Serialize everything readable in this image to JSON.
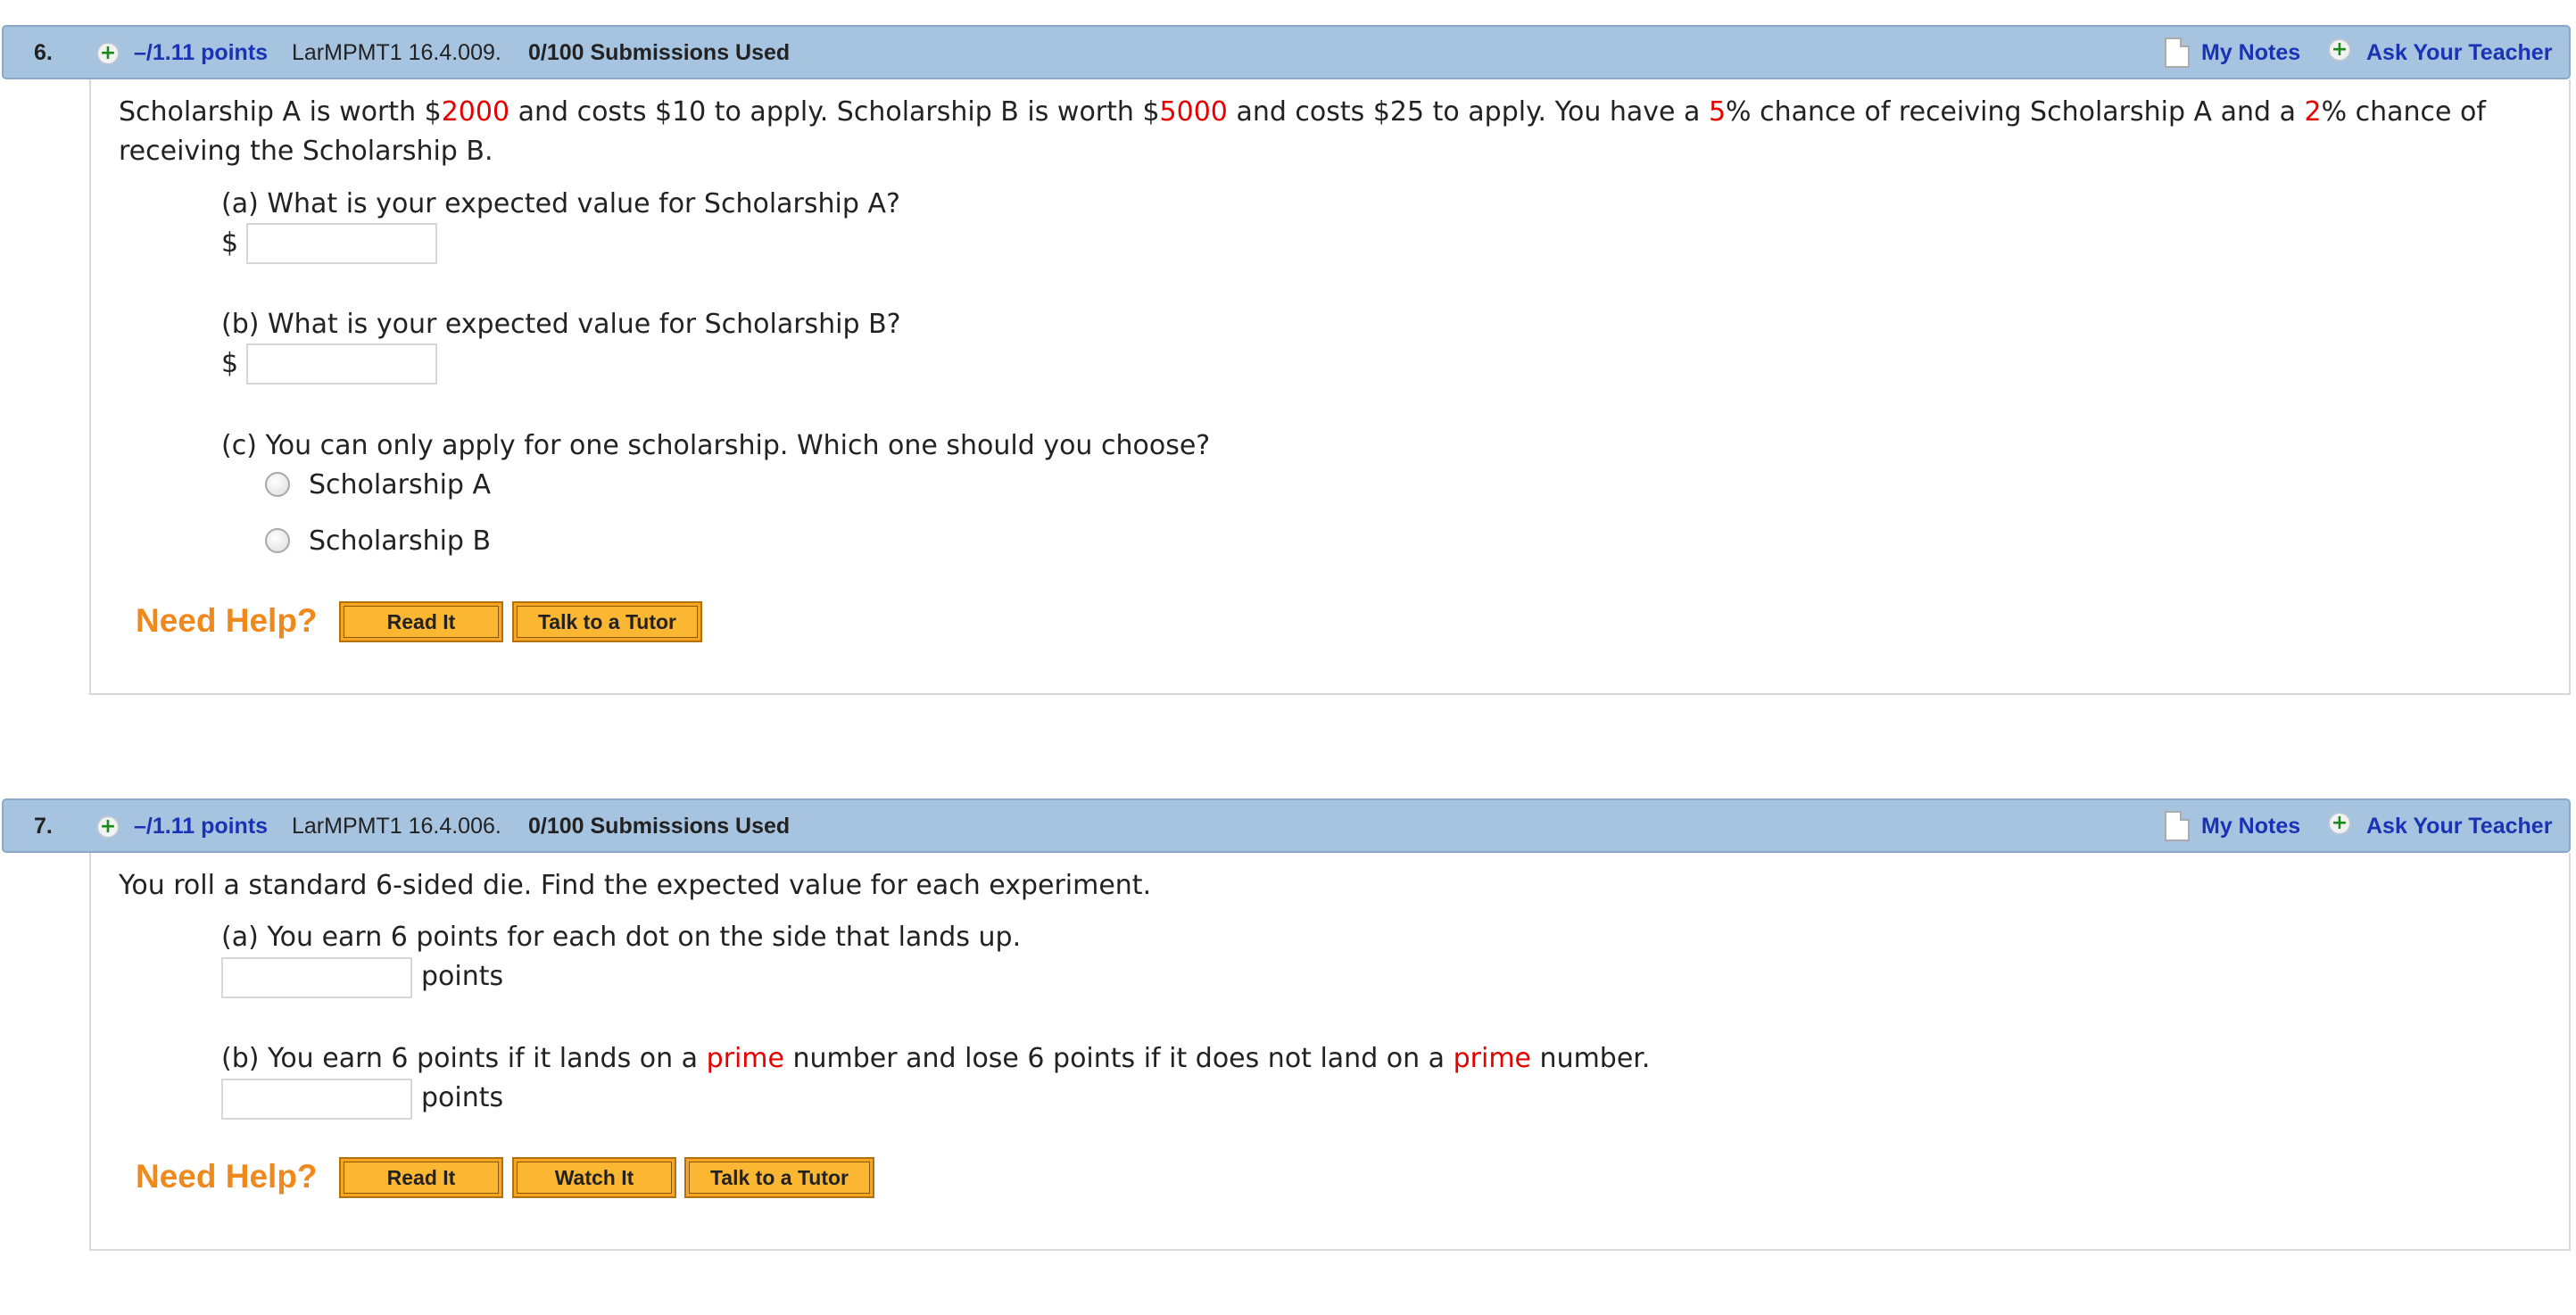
{
  "questions": [
    {
      "number": "6.",
      "points": "–/1.11 points",
      "code": "LarMPMT1 16.4.009.",
      "submissions": "0/100 Submissions Used",
      "my_notes": "My Notes",
      "ask_teacher": "Ask Your Teacher",
      "prompt": {
        "s1": "Scholarship A is worth $",
        "v1": "2000",
        "s2": " and costs $10 to apply. Scholarship B is worth $",
        "v2": "5000",
        "s3": " and costs $25 to apply. You have a ",
        "v3": "5",
        "s4": "% chance of receiving Scholarship A and a ",
        "v4": "2",
        "s5": "% chance of",
        "line2": "receiving the Scholarship B."
      },
      "part_a": "(a) What is your expected value for Scholarship A?",
      "part_a_unit": "$",
      "part_b": "(b) What is your expected value for Scholarship B?",
      "part_b_unit": "$",
      "part_c": "(c) You can only apply for one scholarship. Which one should you choose?",
      "options": [
        "Scholarship A",
        "Scholarship B"
      ],
      "need_help": "Need Help?",
      "buttons": [
        "Read It",
        "Talk to a Tutor"
      ]
    },
    {
      "number": "7.",
      "points": "–/1.11 points",
      "code": "LarMPMT1 16.4.006.",
      "submissions": "0/100 Submissions Used",
      "my_notes": "My Notes",
      "ask_teacher": "Ask Your Teacher",
      "prompt": "You roll a standard 6-sided die. Find the expected value for each experiment.",
      "part_a": "(a) You earn 6 points for each dot on the side that lands up.",
      "part_a_unit": "points",
      "part_b": {
        "s1": "(b) You earn 6 points if it lands on a ",
        "w1": "prime",
        "s2": " number and lose 6 points if it does not land on a ",
        "w2": "prime",
        "s3": " number."
      },
      "part_b_unit": "points",
      "need_help": "Need Help?",
      "buttons": [
        "Read It",
        "Watch It",
        "Talk to a Tutor"
      ]
    }
  ],
  "colors": {
    "header_bg": "#a6c4e0",
    "link": "#1a33b4",
    "highlight": "#e60000",
    "need_help": "#f0891c",
    "button": "#fbb632"
  },
  "icons": [
    "plus-icon",
    "note-icon"
  ]
}
